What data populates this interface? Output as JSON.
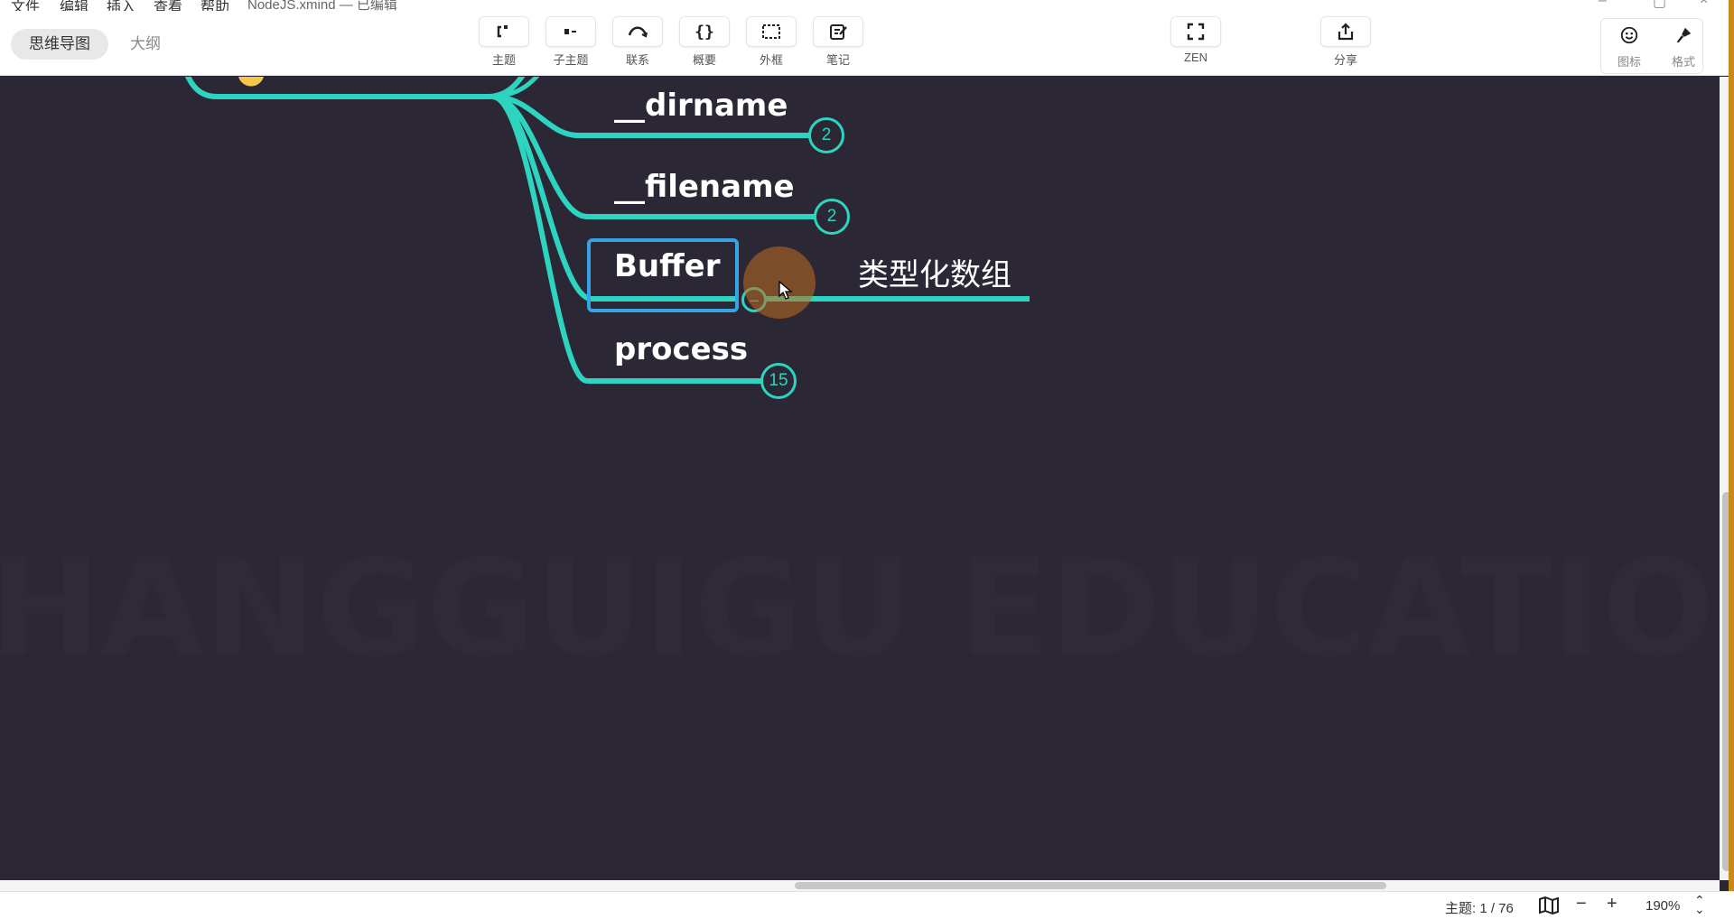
{
  "menubar": {
    "items": [
      "文件",
      "编辑",
      "插入",
      "查看",
      "帮助"
    ],
    "title": "NodeJS.xmind — 已编辑"
  },
  "view_tabs": {
    "mindmap": "思维导图",
    "outline": "大纲"
  },
  "toolbar": {
    "topic": "主题",
    "subtopic": "子主题",
    "relationship": "联系",
    "summary": "概要",
    "boundary": "外框",
    "note": "笔记",
    "zen": "ZEN",
    "share": "分享",
    "icon": "图标",
    "format": "格式"
  },
  "mindmap": {
    "topics": [
      {
        "label": "__dirname",
        "children_count": "2"
      },
      {
        "label": "__filename",
        "children_count": "2"
      },
      {
        "label": "Buffer",
        "child": "类型化数组"
      },
      {
        "label": "process",
        "children_count": "15"
      }
    ]
  },
  "watermark": {
    "text": "SHANGGUIGU EDUCATION"
  },
  "status": {
    "topic_count": "主题: 1 / 76",
    "zoom": "190%"
  },
  "colors": {
    "canvas": "#2c2735",
    "branch": "#2dd4bf",
    "selection": "#35a3e6",
    "topic_text": "#ffffff"
  }
}
